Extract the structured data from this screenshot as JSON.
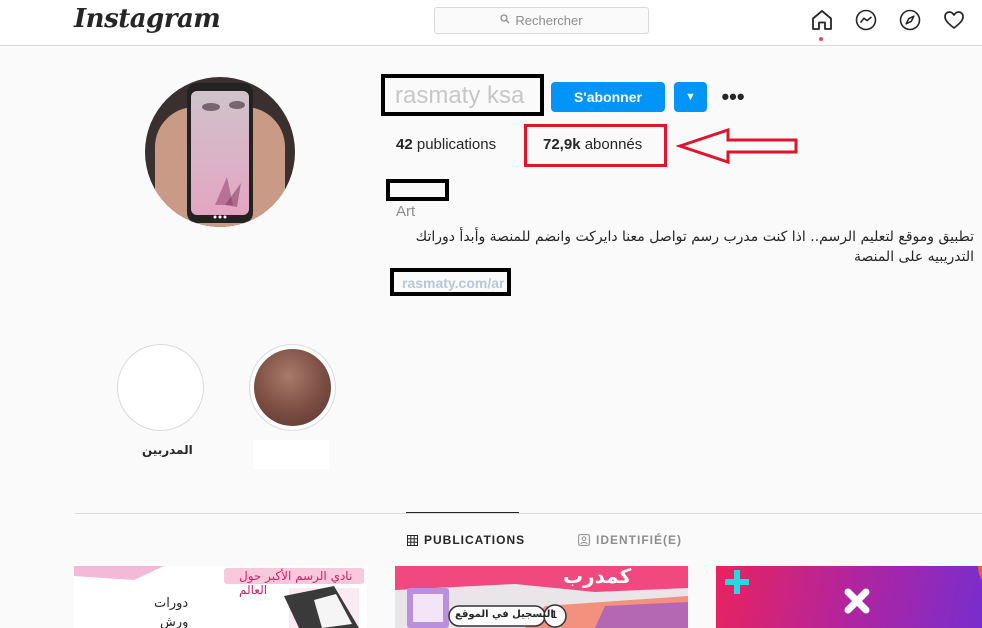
{
  "nav": {
    "logo": "Instagram",
    "search_placeholder": "Rechercher",
    "icons": [
      "home-icon",
      "messenger-icon",
      "explore-icon",
      "heart-icon"
    ]
  },
  "profile": {
    "username": "rasmaty ksa",
    "follow_label": "S'abonner",
    "posts_count": "42",
    "posts_label": "publications",
    "followers_count": "72,9k",
    "followers_label": "abonnés",
    "category": "Art",
    "bio": "تطبيق وموقع لتعليم الرسم.. اذا كنت مدرب رسم تواصل معنا دايركت وانضم للمنصة وأبدأ دوراتك التدريبيه على المنصة",
    "link": "rasmaty.com/ar"
  },
  "highlights": [
    {
      "label": "المدربين"
    },
    {
      "label": ""
    }
  ],
  "tabs": [
    {
      "label": "PUBLICATIONS",
      "icon": "grid-icon",
      "active": true
    },
    {
      "label": "IDENTIFIÉ(E)",
      "icon": "tag-user-icon",
      "active": false
    }
  ],
  "posts": {
    "p1_line1": "نادي الرسم الأكبر حول العالم",
    "p1_line2": "دورات",
    "p1_line3": "ورش",
    "p2_title": "كمدرب",
    "p2_step": "التسجيل في الموقع",
    "p2_num": "1"
  },
  "colors": {
    "accent_blue": "#0095f6",
    "annotation_red": "#e0142a",
    "redaction_black": "#000000"
  }
}
